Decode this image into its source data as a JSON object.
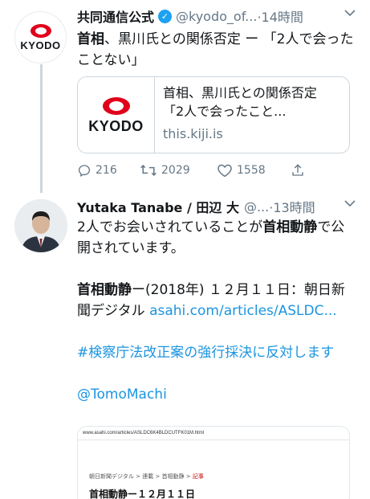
{
  "tweet1": {
    "display_name": "共同通信公式",
    "handle": "@kyodo_of...",
    "time": "·14時間",
    "logo_text": "KYODO",
    "text_bold": "首相",
    "text_rest": "、黒川氏との関係否定 ー 「2人で会ったことない」",
    "card": {
      "logo_text": "KYODO",
      "title": "首相、黒川氏との関係否定　「2人で会ったこと...",
      "domain": "this.kiji.is"
    },
    "replies": "216",
    "retweets": "2029",
    "likes": "1558"
  },
  "tweet2": {
    "display_name": "Yutaka Tanabe / 田辺 大",
    "handle": "@...",
    "time": "·13時間",
    "line1_pre": "2人でお会いされていることが",
    "line1_bold": "首相動静",
    "line1_post": "で公開されています。",
    "line2_bold": "首相動静",
    "line2_rest": "ー(2018年) １２月１１日：朝日新聞デジタル ",
    "line2_link": "asahi.com/articles/ASLDC...",
    "hashtag": "#検察庁法改正案の強行採決に反対します",
    "mention": "@TomoMachi",
    "preview": {
      "url": "www.asahi.com/articles/ASLDC6K4BLDCUTFK01M.html",
      "breadcrumb_1": "朝日新聞デジタル",
      "breadcrumb_2": "連載",
      "breadcrumb_3": "首相動静",
      "breadcrumb_4": "記事",
      "sep": ">",
      "heading": "首相動静ー１２月１１日"
    }
  },
  "colors": {
    "accent": "#1da1f2",
    "link": "#1b95e0",
    "secondary_text": "#657786",
    "kyodo_red": "#e0001b"
  }
}
